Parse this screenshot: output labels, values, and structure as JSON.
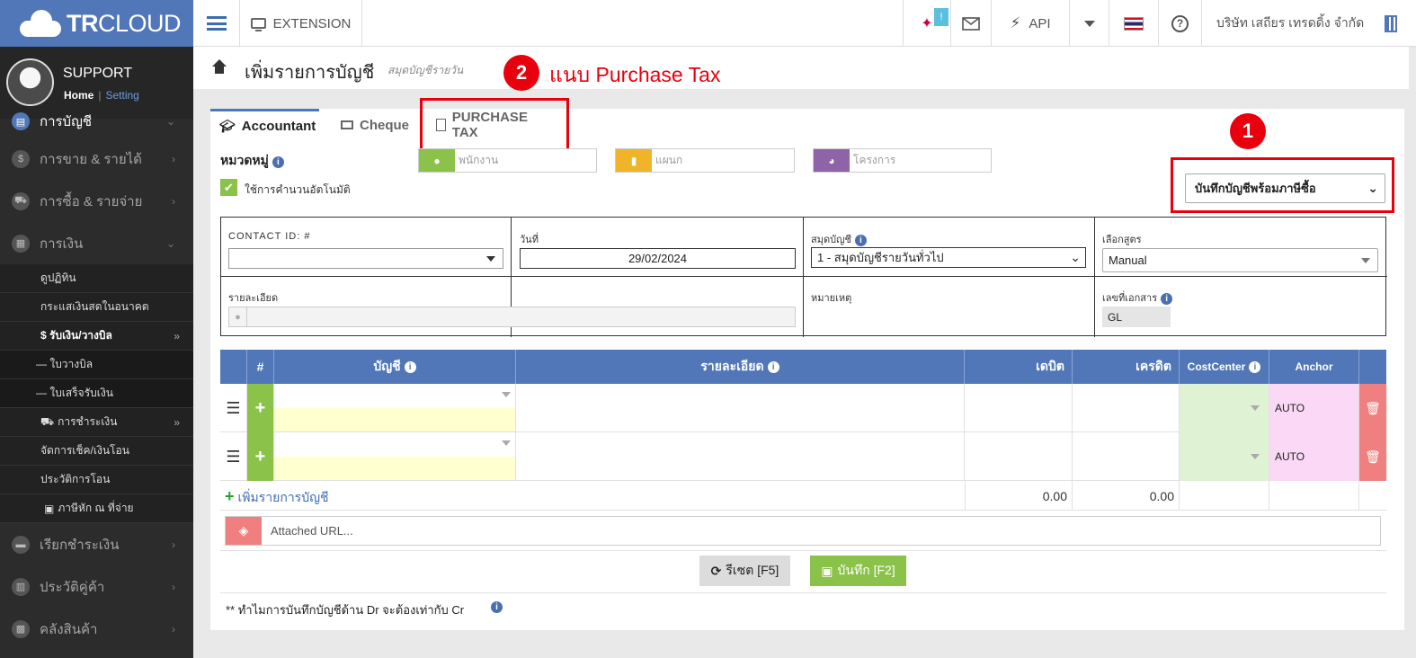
{
  "app": {
    "brand_bold": "TR",
    "brand_light": "CLOUD"
  },
  "topbar": {
    "extension_label": "EXTENSION",
    "notification_count": "!",
    "api_label": "API",
    "company_name": "บริษัท เสถียร เทรดดิ้ง จำกัด"
  },
  "sidebar": {
    "user_name": "SUPPORT",
    "home_link": "Home",
    "setting_link": "Setting",
    "menu": [
      {
        "label": "การบัญชี"
      },
      {
        "label": "การขาย & รายได้"
      },
      {
        "label": "การซื้อ & รายจ่าย"
      },
      {
        "label": "การเงิน"
      }
    ],
    "finance_sub": [
      {
        "label": "ดูปฏิทิน"
      },
      {
        "label": "กระแสเงินสดในอนาคต"
      },
      {
        "label": "$ รับเงิน/วางบิล"
      },
      {
        "label": "— ใบวางบิล"
      },
      {
        "label": "— ใบเสร็จรับเงิน"
      },
      {
        "label": "การชำระเงิน"
      },
      {
        "label": "จัดการเช็ค/เงินโอน"
      },
      {
        "label": "ประวัติการโอน"
      },
      {
        "label": "ภาษีหัก ณ ที่จ่าย"
      }
    ],
    "menu_bottom": [
      {
        "label": "เรียกชำระเงิน"
      },
      {
        "label": "ประวัติคู่ค้า"
      },
      {
        "label": "คลังสินค้า"
      }
    ]
  },
  "page": {
    "title": "เพิ่มรายการบัญชี",
    "subtitle": "สมุดบัญชีรายวัน",
    "annotation_1": "1",
    "annotation_2": "2",
    "annotation_2_text": "แนบ Purchase Tax"
  },
  "tabs": [
    {
      "label": "Accountant"
    },
    {
      "label": "Cheque"
    },
    {
      "label": "PURCHASE TAX"
    }
  ],
  "form": {
    "category_label": "หมวดหมู่",
    "auto_calc_label": "ใช้การคำนวนอัตโนมัติ",
    "employee_placeholder": "พนักงาน",
    "department_placeholder": "แผนก",
    "project_placeholder": "โครงการ",
    "record_mode": "บันทึกบัญชีพร้อมภาษีซื้อ",
    "contact_label": "CONTACT ID: #",
    "date_label": "วันที่",
    "date_value": "29/02/2024",
    "journal_label": "สมุดบัญชี",
    "journal_value": "1 - สมุดบัญชีรายวันทั่วไป",
    "formula_label": "เลือกสูตร",
    "formula_value": "Manual",
    "detail_label": "รายละเอียด",
    "remark_label": "หมายเหตุ",
    "docno_label": "เลขที่เอกสาร",
    "docno_value": "GL"
  },
  "table": {
    "headers": {
      "hash": "#",
      "account": "บัญชี",
      "detail": "รายละเอียด",
      "debit": "เดบิต",
      "credit": "เครดิต",
      "costcenter": "CostCenter",
      "anchor": "Anchor"
    },
    "rows": [
      {
        "anchor": "AUTO"
      },
      {
        "anchor": "AUTO"
      }
    ],
    "add_row_label": "เพิ่มรายการบัญชี",
    "total_debit": "0.00",
    "total_credit": "0.00",
    "url_placeholder": "Attached URL...",
    "reset_label": "รีเซต [F5]",
    "save_label": "บันทึก [F2]",
    "footnote": "** ทำไมการบันทึกบัญชีด้าน Dr จะต้องเท่ากับ Cr"
  },
  "colors": {
    "brand": "#5177b8",
    "accent_red": "#e8000d",
    "green": "#8bc34a",
    "yellow": "#f0b429",
    "purple": "#8e63a8"
  }
}
